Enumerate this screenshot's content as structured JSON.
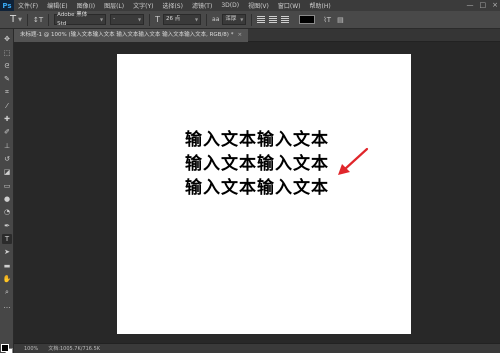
{
  "app": {
    "logo": "Ps"
  },
  "menu": [
    "文件(F)",
    "编辑(E)",
    "图像(I)",
    "图层(L)",
    "文字(Y)",
    "选择(S)",
    "滤镜(T)",
    "3D(D)",
    "视图(V)",
    "窗口(W)",
    "帮助(H)"
  ],
  "window_controls": {
    "minimize": "—",
    "maximize": "□",
    "close": "×"
  },
  "options": {
    "tool_glyph": "T",
    "orient_glyph": "↕T",
    "font_family": "Adobe 黑体 Std",
    "font_style": "-",
    "size_glyph": "T",
    "font_size": "26 点",
    "aa_glyph": "aa",
    "antialias": "浑厚",
    "text_color": "#000000"
  },
  "tab": {
    "title": "未标题-1 @ 100% (输入文本输入文本 输入文本输入文本 输入文本输入文本, RGB/8) *",
    "close": "×"
  },
  "canvas": {
    "lines": [
      "输入文本输入文本",
      "输入文本输入文本",
      "输入文本输入文本"
    ],
    "arrow_color": "#e0262b"
  },
  "status": {
    "zoom": "100%",
    "doc": "文档:1005.7K/716.5K"
  }
}
